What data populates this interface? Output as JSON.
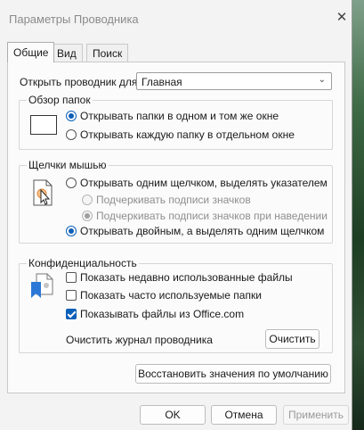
{
  "window": {
    "title": "Параметры Проводника",
    "close_glyph": "✕"
  },
  "tabs": [
    {
      "label": "Общие",
      "active": true
    },
    {
      "label": "Вид",
      "active": false
    },
    {
      "label": "Поиск",
      "active": false
    }
  ],
  "open_explorer": {
    "label": "Открыть проводник для:",
    "value": "Главная"
  },
  "browse_folders": {
    "legend": "Обзор папок",
    "options": [
      {
        "label": "Открывать папки в одном и том же окне",
        "selected": true
      },
      {
        "label": "Открывать каждую папку в отдельном окне",
        "selected": false
      }
    ]
  },
  "click_items": {
    "legend": "Щелчки мышью",
    "single_click": {
      "label": "Открывать одним щелчком, выделять указателем",
      "selected": false
    },
    "underline_always": {
      "label": "Подчеркивать подписи значков",
      "selected": false,
      "enabled": false
    },
    "underline_hover": {
      "label": "Подчеркивать подписи значков при наведении",
      "selected": true,
      "enabled": false
    },
    "double_click": {
      "label": "Открывать двойным, а выделять одним щелчком",
      "selected": true
    }
  },
  "privacy": {
    "legend": "Конфиденциальность",
    "recent_files": {
      "label": "Показать недавно использованные файлы",
      "checked": false
    },
    "frequent_folders": {
      "label": "Показать часто используемые папки",
      "checked": false
    },
    "office_files": {
      "label": "Показывать файлы из Office.com",
      "checked": true
    },
    "clear_label": "Очистить журнал проводника",
    "clear_button": "Очистить"
  },
  "restore_defaults": "Восстановить значения по умолчанию",
  "footer": {
    "ok": "OK",
    "cancel": "Отмена",
    "apply": "Применить"
  },
  "colors": {
    "accent": "#0a5fb8",
    "window_bg": "#f3f3f3",
    "panel_bg": "#fbfbfb"
  },
  "icons": [
    "close-icon",
    "chevron-down-icon",
    "window-icon",
    "mouse-click-icon",
    "privacy-icon"
  ]
}
